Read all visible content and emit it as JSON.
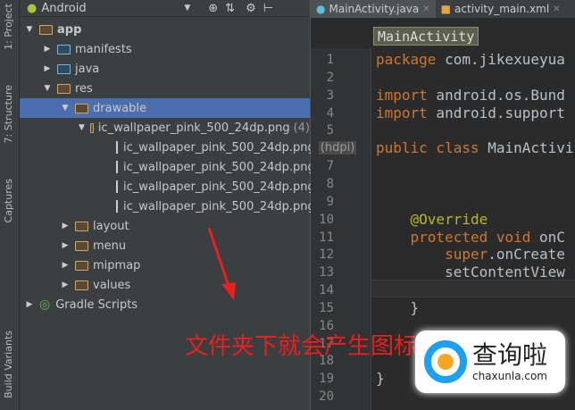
{
  "tool_strip": [
    "1: Project",
    "7: Structure",
    "Captures",
    "Build Variants"
  ],
  "panel": {
    "view_selector": "Android",
    "tree": [
      {
        "label": "app",
        "depth": 0,
        "expanded": true,
        "icon": "module-folder-icon"
      },
      {
        "label": "manifests",
        "depth": 1,
        "expanded": false,
        "icon": "folder-icon"
      },
      {
        "label": "java",
        "depth": 1,
        "expanded": false,
        "icon": "folder-icon"
      },
      {
        "label": "res",
        "depth": 1,
        "expanded": true,
        "icon": "res-folder-icon"
      },
      {
        "label": "drawable",
        "depth": 2,
        "expanded": true,
        "icon": "folder-icon",
        "selected": true
      },
      {
        "label": "ic_wallpaper_pink_500_24dp.png",
        "suffix": "(4)",
        "depth": 3,
        "expanded": true,
        "icon": "folder-icon"
      },
      {
        "label": "ic_wallpaper_pink_500_24dp.png",
        "suffix": "(hdpi)",
        "depth": 4,
        "icon": "image-file-icon"
      },
      {
        "label": "ic_wallpaper_pink_500_24dp.png",
        "depth": 4,
        "icon": "image-file-icon"
      },
      {
        "label": "ic_wallpaper_pink_500_24dp.png",
        "depth": 4,
        "icon": "image-file-icon"
      },
      {
        "label": "ic_wallpaper_pink_500_24dp.png",
        "depth": 4,
        "icon": "image-file-icon"
      },
      {
        "label": "layout",
        "depth": 2,
        "expanded": false,
        "icon": "folder-icon"
      },
      {
        "label": "menu",
        "depth": 2,
        "expanded": false,
        "icon": "folder-icon"
      },
      {
        "label": "mipmap",
        "depth": 2,
        "expanded": false,
        "icon": "folder-icon"
      },
      {
        "label": "values",
        "depth": 2,
        "expanded": false,
        "icon": "folder-icon"
      },
      {
        "label": "Gradle Scripts",
        "depth": 0,
        "expanded": false,
        "icon": "gradle-icon"
      }
    ]
  },
  "editor": {
    "tabs": [
      {
        "label": "MainActivity.java",
        "active": true
      },
      {
        "label": "activity_main.xml",
        "active": false
      }
    ],
    "breadcrumb": "MainActivity",
    "lines": [
      {
        "n": "1",
        "kw": "package",
        "rest": " com.jikexueyua"
      },
      {
        "n": "2",
        "kw": "",
        "rest": ""
      },
      {
        "n": "3",
        "kw": "import",
        "rest": " android.os.Bund"
      },
      {
        "n": "4",
        "kw": "import",
        "rest": " android.support"
      },
      {
        "n": "5",
        "kw": "",
        "rest": ""
      },
      {
        "n": "6",
        "kw": "public class",
        "rest": " MainActivi"
      },
      {
        "n": "7",
        "kw": "",
        "rest": ""
      },
      {
        "n": "8",
        "kw": "",
        "rest": ""
      },
      {
        "n": "9",
        "kw": "",
        "rest": ""
      },
      {
        "n": "10",
        "an": "    @Override",
        "kw": "",
        "rest": ""
      },
      {
        "n": "11",
        "kw": "    protected void",
        "rest": " onC"
      },
      {
        "n": "12",
        "kw": "        super",
        "rest": ".onCreate"
      },
      {
        "n": "13",
        "kw": "",
        "rest": "        setContentView"
      },
      {
        "n": "14",
        "kw": "",
        "rest": ""
      },
      {
        "n": "15",
        "kw": "",
        "rest": "    }"
      },
      {
        "n": "16",
        "kw": "",
        "rest": ""
      },
      {
        "n": "17",
        "kw": "",
        "rest": ""
      },
      {
        "n": "18",
        "kw": "",
        "rest": ""
      },
      {
        "n": "19",
        "kw": "",
        "rest": "}"
      },
      {
        "n": "20",
        "kw": "",
        "rest": ""
      }
    ]
  },
  "annotation": {
    "caption": "文件夹下就会产生图标",
    "color": "#e8201e"
  },
  "watermark": {
    "name": "查询啦",
    "domain": "chaxunla.com"
  }
}
